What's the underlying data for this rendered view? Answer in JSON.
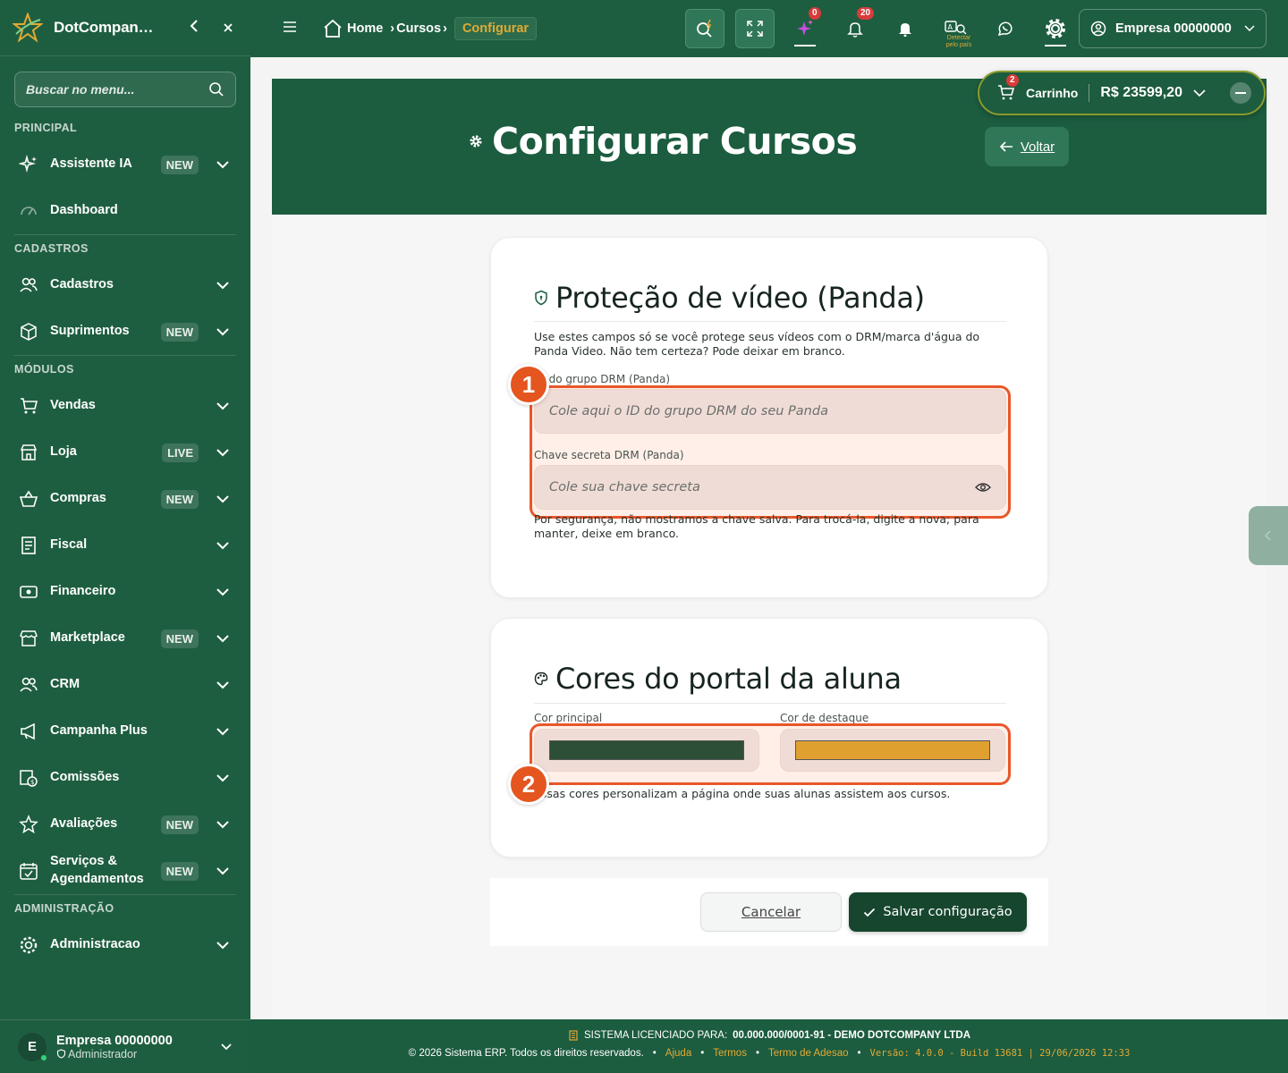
{
  "sidebar": {
    "brand": "DotCompan…",
    "search_placeholder": "Buscar no menu...",
    "sections": {
      "principal": "PRINCIPAL",
      "cadastros": "CADASTROS",
      "modulos": "MÓDULOS",
      "administracao": "ADMINISTRAÇÃO"
    },
    "items": [
      {
        "label": "Assistente IA",
        "badge": "NEW"
      },
      {
        "label": "Dashboard",
        "badge": ""
      },
      {
        "label": "Cadastros",
        "badge": ""
      },
      {
        "label": "Suprimentos",
        "badge": "NEW"
      },
      {
        "label": "Vendas",
        "badge": ""
      },
      {
        "label": "Loja",
        "badge": "LIVE"
      },
      {
        "label": "Compras",
        "badge": "NEW"
      },
      {
        "label": "Fiscal",
        "badge": ""
      },
      {
        "label": "Financeiro",
        "badge": ""
      },
      {
        "label": "Marketplace",
        "badge": "NEW"
      },
      {
        "label": "CRM",
        "badge": ""
      },
      {
        "label": "Campanha Plus",
        "badge": ""
      },
      {
        "label": "Comissões",
        "badge": ""
      },
      {
        "label": "Avaliações",
        "badge": "NEW"
      },
      {
        "label": "Serviços & Agendamentos",
        "badge": "NEW"
      },
      {
        "label": "Administracao",
        "badge": ""
      }
    ],
    "user": {
      "initial": "E",
      "name": "Empresa 00000000",
      "role": "Administrador"
    }
  },
  "topbar": {
    "breadcrumb": {
      "home": "Home",
      "cursos": "Cursos",
      "current": "Configurar"
    },
    "ai_count": "0",
    "notif_count": "20",
    "detect_label": "Detectar pelo país",
    "company": "Empresa 00000000"
  },
  "cart": {
    "label": "Carrinho",
    "count": "2",
    "total": "R$ 23599,20"
  },
  "page": {
    "title": "Configurar Cursos",
    "back_label": "Voltar"
  },
  "panda": {
    "title": "Proteção de vídeo (Panda)",
    "description": "Use estes campos só se você protege seus vídeos com o DRM/marca d'água do Panda Video. Não tem certeza? Pode deixar em branco.",
    "group_label": "ID do grupo DRM (Panda)",
    "group_placeholder": "Cole aqui o ID do grupo DRM do seu Panda",
    "secret_label": "Chave secreta DRM (Panda)",
    "secret_placeholder": "Cole sua chave secreta",
    "secret_help": "Por segurança, não mostramos a chave salva. Para trocá-la, digite a nova; para manter, deixe em branco."
  },
  "colors": {
    "title": "Cores do portal da aluna",
    "primary_label": "Cor principal",
    "primary_value": "#2d4e37",
    "accent_label": "Cor de destaque",
    "accent_value": "#e0a030",
    "help": "Essas cores personalizam a página onde suas alunas assistem aos cursos."
  },
  "annotations": {
    "step1": "1",
    "step2": "2"
  },
  "actions": {
    "cancel": "Cancelar",
    "save": "Salvar configuração"
  },
  "footer": {
    "licensed_prefix": "SISTEMA LICENCIADO PARA:",
    "licensed_to": "00.000.000/0001-91 - DEMO DOTCOMPANY LTDA",
    "copyright": "© 2026 Sistema ERP. Todos os direitos reservados.",
    "links": [
      "Ajuda",
      "Termos",
      "Termo de Adesao"
    ],
    "version": "Versão: 4.0.0 - Build 13681 | 29/06/2026 12:33"
  },
  "theme": {
    "primary": "#1e5e40",
    "accent": "#e3a934",
    "highlight": "#e8572a"
  }
}
